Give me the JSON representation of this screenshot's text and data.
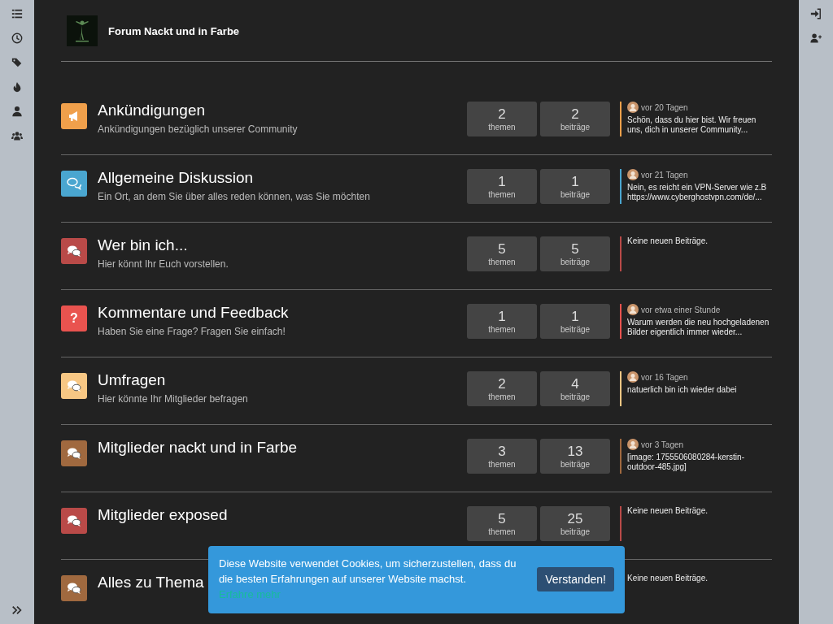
{
  "header": {
    "title": "Forum Nackt und in Farbe"
  },
  "left_sidebar": [
    {
      "kind": "list"
    },
    {
      "kind": "clock"
    },
    {
      "kind": "tags"
    },
    {
      "kind": "fire"
    },
    {
      "kind": "user"
    },
    {
      "kind": "users"
    }
  ],
  "right_sidebar": [
    {
      "kind": "login"
    },
    {
      "kind": "user-plus"
    }
  ],
  "categories": [
    {
      "title": "Ankündigungen",
      "description": "Ankündigungen bezüglich unserer Community",
      "color": "#f0a04b",
      "kind": "megaphone",
      "topics": "2",
      "topics_label": "themen",
      "posts": "2",
      "posts_label": "beiträge",
      "last_post": {
        "time": "vor 20 Tagen",
        "text": "Schön, dass du hier bist. Wir freuen uns, dich in unserer Community..."
      }
    },
    {
      "title": "Allgemeine Diskussion",
      "description": "Ein Ort, an dem Sie über alles reden können, was Sie möchten",
      "color": "#4aa6d0",
      "kind": "comments-outline",
      "topics": "1",
      "topics_label": "themen",
      "posts": "1",
      "posts_label": "beiträge",
      "last_post": {
        "time": "vor 21 Tagen",
        "text": "Nein, es reicht ein VPN-Server wie z.B https://www.cyberghostvpn.com/de/..."
      }
    },
    {
      "title": "Wer bin ich...",
      "description": "Hier könnt Ihr Euch vorstellen.",
      "color": "#b94a48",
      "kind": "comments",
      "topics": "5",
      "topics_label": "themen",
      "posts": "5",
      "posts_label": "beiträge",
      "last_post": {
        "text": "Keine neuen Beiträge."
      }
    },
    {
      "title": "Kommentare und Feedback",
      "description": "Haben Sie eine Frage? Fragen Sie einfach!",
      "color": "#e9534f",
      "kind": "text",
      "icon_text": "?",
      "topics": "1",
      "topics_label": "themen",
      "posts": "1",
      "posts_label": "beiträge",
      "last_post": {
        "time": "vor etwa einer Stunde",
        "text": "Warum werden die neu hochgeladenen Bilder eigentlich immer wieder..."
      }
    },
    {
      "title": "Umfragen",
      "description": "Hier könnte Ihr Mitglieder befragen",
      "color": "#f7c784",
      "kind": "comments",
      "topics": "2",
      "topics_label": "themen",
      "posts": "4",
      "posts_label": "beiträge",
      "last_post": {
        "time": "vor 16 Tagen",
        "text": "natuerlich bin ich wieder dabei"
      }
    },
    {
      "title": "Mitglieder nackt und in Farbe",
      "color": "#a0693f",
      "kind": "comments",
      "topics": "3",
      "topics_label": "themen",
      "posts": "13",
      "posts_label": "beiträge",
      "last_post": {
        "time": "vor 3 Tagen",
        "text": "[image: 1755506080284-kerstin-outdoor-485.jpg]"
      }
    },
    {
      "title": "Mitglieder exposed",
      "color": "#b94a48",
      "kind": "comments",
      "topics": "5",
      "topics_label": "themen",
      "posts": "25",
      "posts_label": "beiträge",
      "last_post": {
        "text": "Keine neuen Beiträge."
      }
    },
    {
      "title": "Alles zu Thema",
      "color": "#a0693f",
      "kind": "comments",
      "last_post": {
        "text": "Keine neuen Beiträge."
      }
    }
  ],
  "cookie_banner": {
    "text": "Diese Website verwendet Cookies, um sicherzustellen, dass du die besten Erfahrungen auf unserer Website machst.",
    "link": "Erfahre mehr",
    "button": "Verstanden!"
  }
}
